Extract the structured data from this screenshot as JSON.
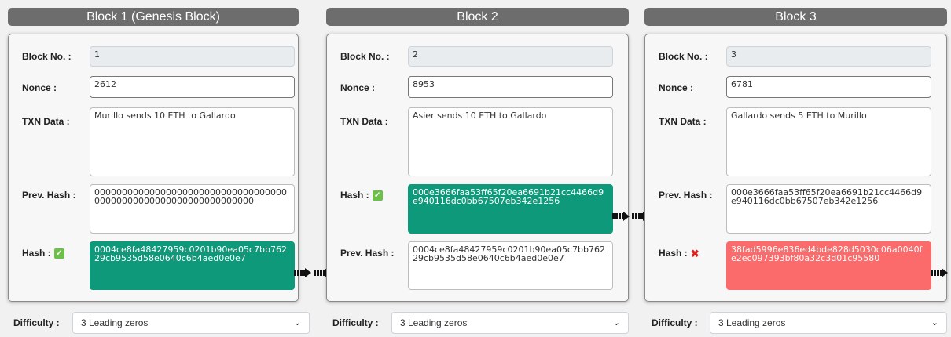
{
  "blocks": [
    {
      "title": "Block 1 (Genesis Block)",
      "labels": {
        "block_no": "Block No. :",
        "nonce": "Nonce :",
        "data": "TXN Data :",
        "prev_hash": "Prev. Hash :",
        "hash": "Hash :"
      },
      "block_no": "1",
      "nonce": "2612",
      "txn_data": "Murillo sends 10 ETH to Gallardo",
      "prev_hash": "0000000000000000000000000000000000000000000000000000000000000000",
      "hash": "0004ce8fa48427959c0201b90ea05c7bb76229cb9535d58e0640c6b4aed0e0e7",
      "hash_valid": true
    },
    {
      "title": "Block 2",
      "labels": {
        "block_no": "Block No. :",
        "nonce": "Nonce :",
        "data": "TXN Data :",
        "hash": "Hash :",
        "prev_hash": "Prev. Hash :"
      },
      "block_no": "2",
      "nonce": "8953",
      "txn_data": "Asier sends 10 ETH to Gallardo",
      "hash": "000e3666faa53ff65f20ea6691b21cc4466d9e940116dc0bb67507eb342e1256",
      "prev_hash": "0004ce8fa48427959c0201b90ea05c7bb76229cb9535d58e0640c6b4aed0e0e7",
      "hash_valid": true
    },
    {
      "title": "Block 3",
      "labels": {
        "block_no": "Block No. :",
        "nonce": "Nonce :",
        "data": "TXN Data :",
        "prev_hash": "Prev. Hash :",
        "hash": "Hash :"
      },
      "block_no": "3",
      "nonce": "6781",
      "txn_data": "Gallardo sends 5 ETH to Murillo",
      "prev_hash": "000e3666faa53ff65f20ea6691b21cc4466d9e940116dc0bb67507eb342e1256",
      "hash": "38fad5996e836ed4bde828d5030c06a0040fe2ec097393bf80a32c3d01c95580",
      "hash_valid": false
    }
  ],
  "difficulty": {
    "label": "Difficulty :",
    "selected": "3 Leading zeros"
  },
  "colors": {
    "valid_hash_bg": "#0e9a7a",
    "invalid_hash_bg": "#fb6b6b",
    "header_bg": "#6d6d6d",
    "valid_icon": "#6cc04a",
    "invalid_icon": "#e02020"
  },
  "icons": {
    "valid": "check-mark-icon",
    "invalid": "cross-mark-icon",
    "chain": "chain-link-icon",
    "dropdown": "chevron-down-icon"
  }
}
